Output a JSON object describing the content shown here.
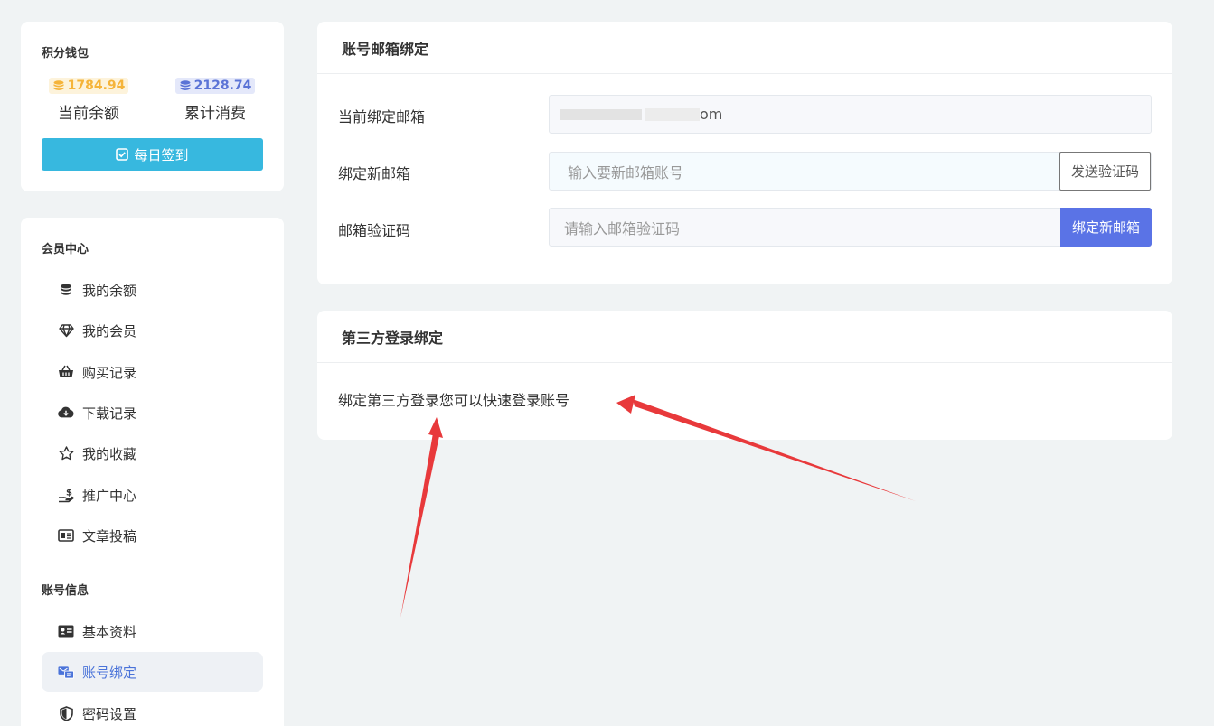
{
  "wallet": {
    "title": "积分钱包",
    "balance": {
      "value": "1784.94",
      "label": "当前余额",
      "icon": "coins-icon"
    },
    "spent": {
      "value": "2128.74",
      "label": "累计消费",
      "icon": "coins-icon"
    },
    "checkin_label": "每日签到",
    "colors": {
      "checkin_button": "#37b8df",
      "balance_badge": "#f5b43a",
      "spent_badge": "#5b73d6"
    }
  },
  "sidebar": {
    "member_center_title": "会员中心",
    "member_items": [
      {
        "label": "我的余额",
        "icon": "coins-icon"
      },
      {
        "label": "我的会员",
        "icon": "diamond-icon"
      },
      {
        "label": "购买记录",
        "icon": "basket-icon"
      },
      {
        "label": "下载记录",
        "icon": "cloud-download-icon"
      },
      {
        "label": "我的收藏",
        "icon": "star-icon"
      },
      {
        "label": "推广中心",
        "icon": "hand-dollar-icon"
      },
      {
        "label": "文章投稿",
        "icon": "newspaper-icon"
      }
    ],
    "account_info_title": "账号信息",
    "account_items": [
      {
        "label": "基本资料",
        "icon": "id-card-icon",
        "active": false
      },
      {
        "label": "账号绑定",
        "icon": "account-bind-icon",
        "active": true
      },
      {
        "label": "密码设置",
        "icon": "shield-icon",
        "active": false
      }
    ],
    "active_color": "#4a73d9"
  },
  "email_binding": {
    "title": "账号邮箱绑定",
    "current_label": "当前绑定邮箱",
    "current_value": "om",
    "new_label": "绑定新邮箱",
    "new_placeholder": "输入要新邮箱账号",
    "send_code_label": "发送验证码",
    "code_label": "邮箱验证码",
    "code_placeholder": "请输入邮箱验证码",
    "bind_button_label": "绑定新邮箱",
    "bind_button_color": "#5a73e6"
  },
  "third_party": {
    "title": "第三方登录绑定",
    "description": "绑定第三方登录您可以快速登录账号"
  },
  "annotation": {
    "arrow_color": "#e8393b"
  }
}
